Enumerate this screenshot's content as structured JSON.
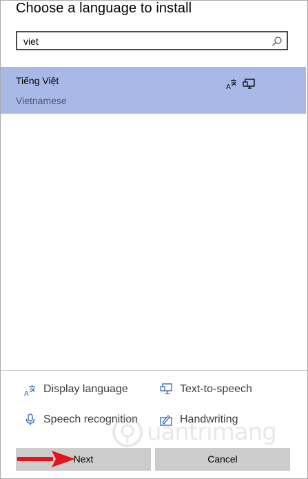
{
  "dialog": {
    "title": "Choose a language to install"
  },
  "search": {
    "value": "viet",
    "placeholder": ""
  },
  "results": [
    {
      "name": "Tiếng Việt",
      "english_name": "Vietnamese",
      "selected": true,
      "feature_icons": [
        "display-language-icon",
        "text-to-speech-icon"
      ]
    }
  ],
  "legend": {
    "display_language": "Display language",
    "text_to_speech": "Text-to-speech",
    "speech_recognition": "Speech recognition",
    "handwriting": "Handwriting"
  },
  "buttons": {
    "next": "Next",
    "cancel": "Cancel"
  },
  "watermark": {
    "text": "uantrimang"
  },
  "colors": {
    "selected_row": "#a8b9e8",
    "button_bg": "#cccccc",
    "arrow": "#e3141b",
    "icon_blue": "#2b5fb3"
  }
}
